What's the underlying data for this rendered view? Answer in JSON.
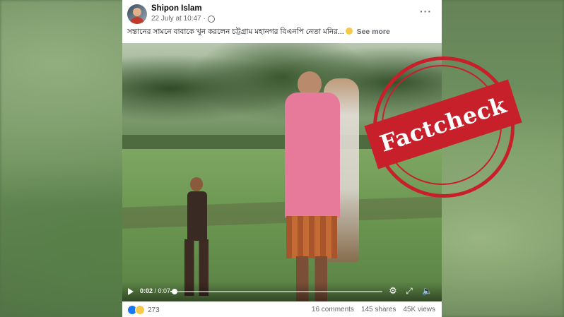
{
  "post": {
    "author": "Shipon Islam",
    "date": "22 July at 10:47",
    "privacy_separator": "·",
    "caption": "সন্তানের সামনে বাবাকে খুন করলেন চট্টগ্রাম মহানগর বিএনপি নেতা মনির...",
    "see_more": "See more",
    "more_menu": "···"
  },
  "video": {
    "current_time": "0:02",
    "separator": " / ",
    "duration": "0:07",
    "progress_fraction": 0.02
  },
  "stamp": {
    "text": "Factcheck",
    "color": "#c8202a"
  },
  "footer": {
    "reaction_count": "273",
    "comments": "16 comments",
    "shares": "145 shares",
    "views": "45K views"
  },
  "icons": [
    "globe-icon",
    "more-icon",
    "play-icon",
    "gear-icon",
    "expand-icon",
    "volume-icon",
    "like-icon",
    "sad-icon"
  ],
  "colors": {
    "accent": "#1877f2",
    "secondary_text": "#65676b"
  }
}
